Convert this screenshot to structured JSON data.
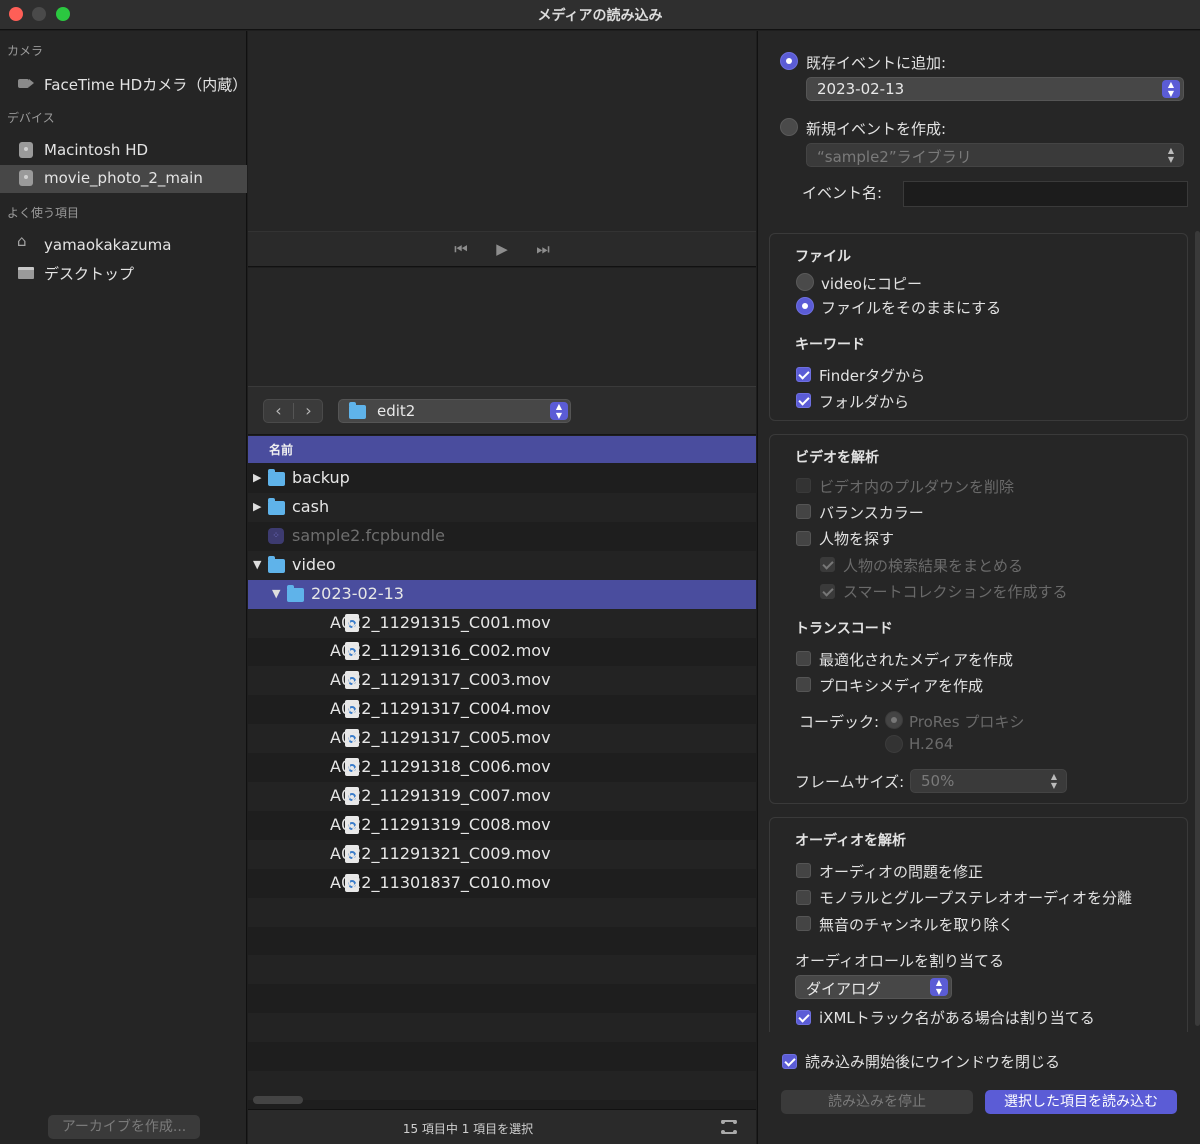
{
  "window": {
    "title": "メディアの読み込み"
  },
  "sidebar": {
    "sections": [
      {
        "header": "カメラ",
        "items": [
          {
            "label": "FaceTime HDカメラ（内蔵）",
            "icon": "camera-icon"
          }
        ]
      },
      {
        "header": "デバイス",
        "items": [
          {
            "label": "Macintosh HD",
            "icon": "disk-icon"
          },
          {
            "label": "movie_photo_2_main",
            "icon": "disk-icon",
            "selected": true
          }
        ]
      },
      {
        "header": "よく使う項目",
        "items": [
          {
            "label": "yamaokakazuma",
            "icon": "home-icon"
          },
          {
            "label": "デスクトップ",
            "icon": "desktop-icon"
          }
        ]
      }
    ],
    "archive_button": "アーカイブを作成..."
  },
  "browser": {
    "folder": "edit2",
    "column_header": "名前",
    "rows": [
      {
        "name": "backup",
        "type": "folder",
        "disclosure": "▶",
        "level": 0
      },
      {
        "name": "cash",
        "type": "folder",
        "disclosure": "▶",
        "level": 0
      },
      {
        "name": "sample2.fcpbundle",
        "type": "bundle",
        "disclosure": "",
        "level": 0,
        "dim": true
      },
      {
        "name": "video",
        "type": "folder",
        "disclosure": "▼",
        "level": 0
      },
      {
        "name": "2023-02-13",
        "type": "folder",
        "disclosure": "▼",
        "level": 1,
        "selected": true
      },
      {
        "name": "A022_11291315_C001.mov",
        "type": "file",
        "level": 2
      },
      {
        "name": "A022_11291316_C002.mov",
        "type": "file",
        "level": 2
      },
      {
        "name": "A022_11291317_C003.mov",
        "type": "file",
        "level": 2
      },
      {
        "name": "A022_11291317_C004.mov",
        "type": "file",
        "level": 2
      },
      {
        "name": "A022_11291317_C005.mov",
        "type": "file",
        "level": 2
      },
      {
        "name": "A022_11291318_C006.mov",
        "type": "file",
        "level": 2
      },
      {
        "name": "A022_11291319_C007.mov",
        "type": "file",
        "level": 2
      },
      {
        "name": "A022_11291319_C008.mov",
        "type": "file",
        "level": 2
      },
      {
        "name": "A022_11291321_C009.mov",
        "type": "file",
        "level": 2
      },
      {
        "name": "A022_11301837_C010.mov",
        "type": "file",
        "level": 2
      }
    ],
    "status": "15 項目中 1 項目を選択"
  },
  "options": {
    "add_existing_label": "既存イベントに追加:",
    "existing_event": "2023-02-13",
    "new_event_label": "新規イベントを作成:",
    "library": "“sample2”ライブラリ",
    "event_name_label": "イベント名:",
    "event_name_value": "",
    "files": {
      "header": "ファイル",
      "copy_label": "videoにコピー",
      "leave_label": "ファイルをそのままにする"
    },
    "keywords": {
      "header": "キーワード",
      "finder_tags": "Finderタグから",
      "folders": "フォルダから"
    },
    "video_analysis": {
      "header": "ビデオを解析",
      "remove_pulldown": "ビデオ内のプルダウンを削除",
      "balance_color": "バランスカラー",
      "find_people": "人物を探す",
      "consolidate": "人物の検索結果をまとめる",
      "smart_collections": "スマートコレクションを作成する"
    },
    "transcode": {
      "header": "トランスコード",
      "optimized": "最適化されたメディアを作成",
      "proxy": "プロキシメディアを作成",
      "codec_label": "コーデック:",
      "codec_prores": "ProRes プロキシ",
      "codec_h264": "H.264",
      "frame_size_label": "フレームサイズ:",
      "frame_size": "50%"
    },
    "audio_analysis": {
      "header": "オーディオを解析",
      "fix_problems": "オーディオの問題を修正",
      "separate_mono": "モノラルとグループステレオオーディオを分離",
      "remove_silent": "無音のチャンネルを取り除く"
    },
    "audio_roles": {
      "header": "オーディオロールを割り当てる",
      "role": "ダイアログ",
      "ixml": "iXMLトラック名がある場合は割り当てる"
    },
    "close_window": "読み込み開始後にウインドウを閉じる",
    "stop_button": "読み込みを停止",
    "import_button": "選択した項目を読み込む"
  },
  "colors": {
    "accent": "#5b5cd6",
    "selection": "#4a4d9e",
    "folder": "#5fb3ea"
  }
}
